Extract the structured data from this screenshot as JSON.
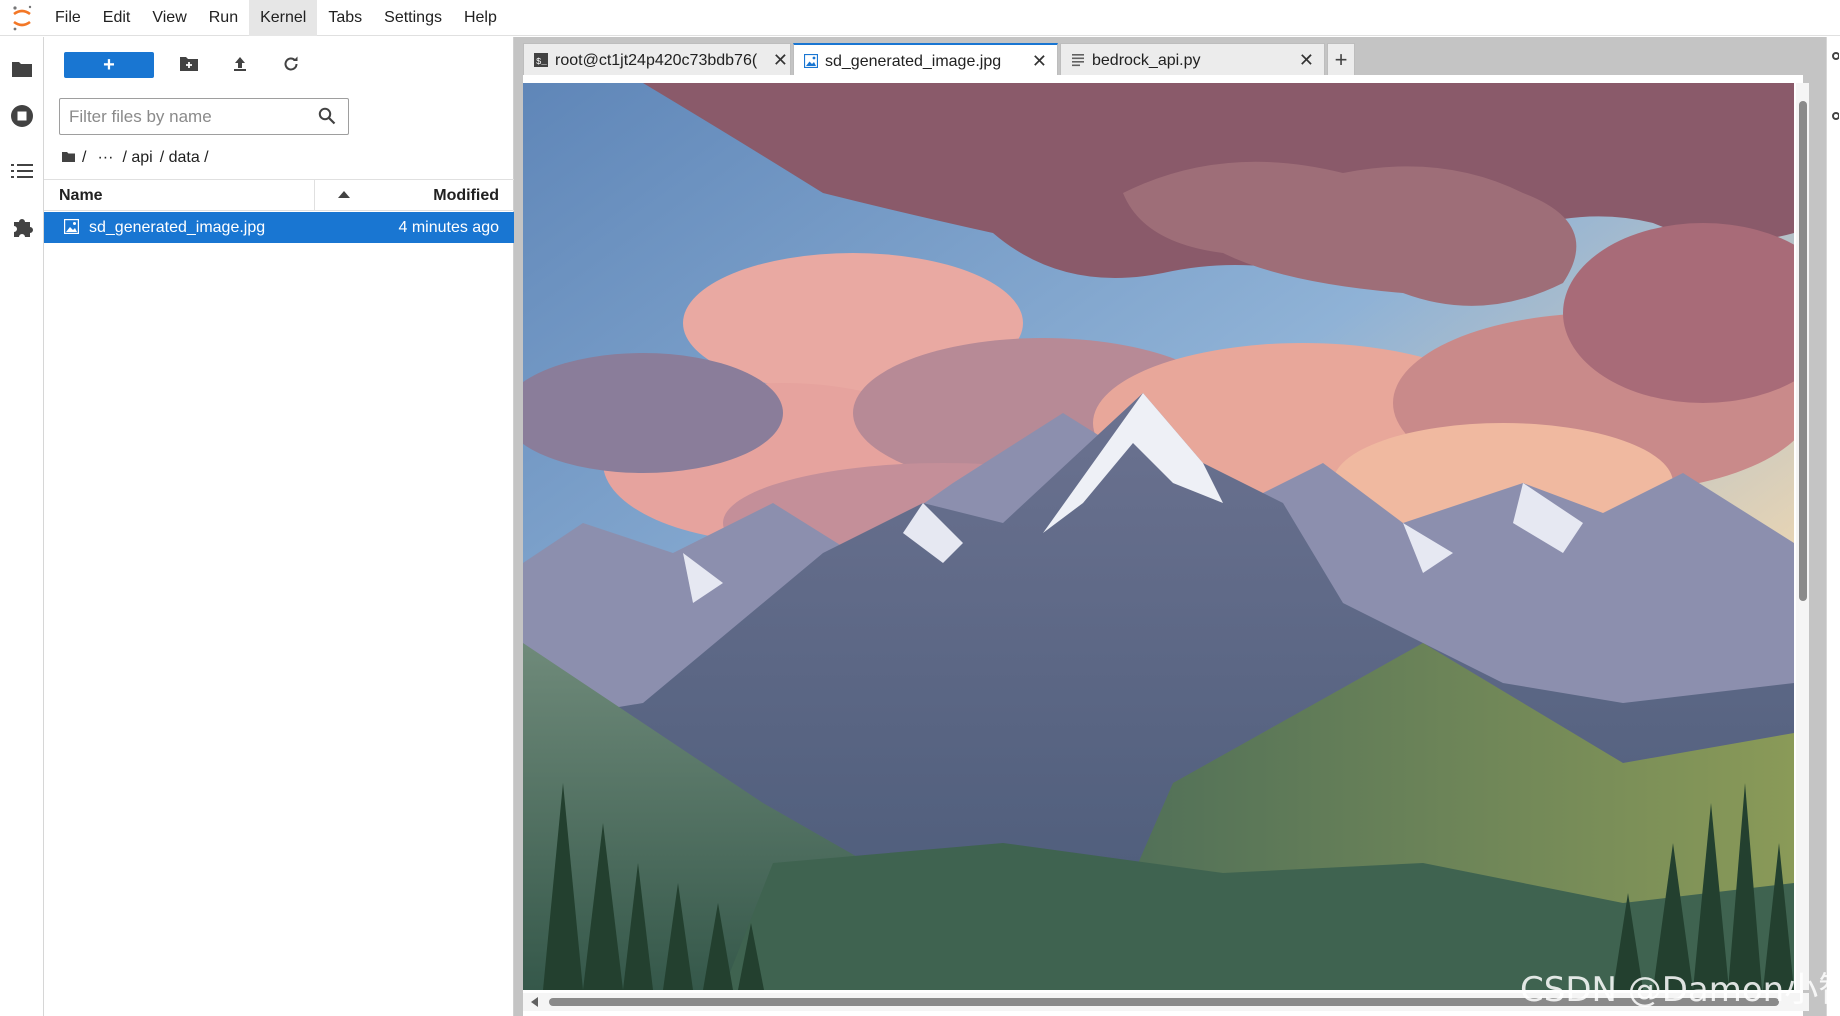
{
  "menubar": {
    "items": [
      "File",
      "Edit",
      "View",
      "Run",
      "Kernel",
      "Tabs",
      "Settings",
      "Help"
    ],
    "active": "Kernel"
  },
  "activitybar": {
    "icons": [
      "folder-icon",
      "running-stop-icon",
      "table-of-contents-icon",
      "extension-puzzle-icon"
    ]
  },
  "filebrowser": {
    "new_button_label": "+",
    "filter_placeholder": "Filter files by name",
    "breadcrumb": [
      "/",
      "···",
      "/ api",
      "/ data /"
    ],
    "columns": {
      "name": "Name",
      "modified": "Modified"
    },
    "files": [
      {
        "name": "sd_generated_image.jpg",
        "modified": "4 minutes ago",
        "selected": true
      }
    ]
  },
  "tabs": [
    {
      "label": "root@ct1jt24p420c73bdb76(",
      "icon": "terminal-icon",
      "active": false
    },
    {
      "label": "sd_generated_image.jpg",
      "icon": "image-file-icon",
      "active": true
    },
    {
      "label": "bedrock_api.py",
      "icon": "text-file-icon",
      "active": false
    }
  ],
  "add_tab_label": "+",
  "colors": {
    "accent": "#1976d2",
    "dock_bg": "#c4c4c4"
  },
  "watermark": "CSDN @Damon小智"
}
